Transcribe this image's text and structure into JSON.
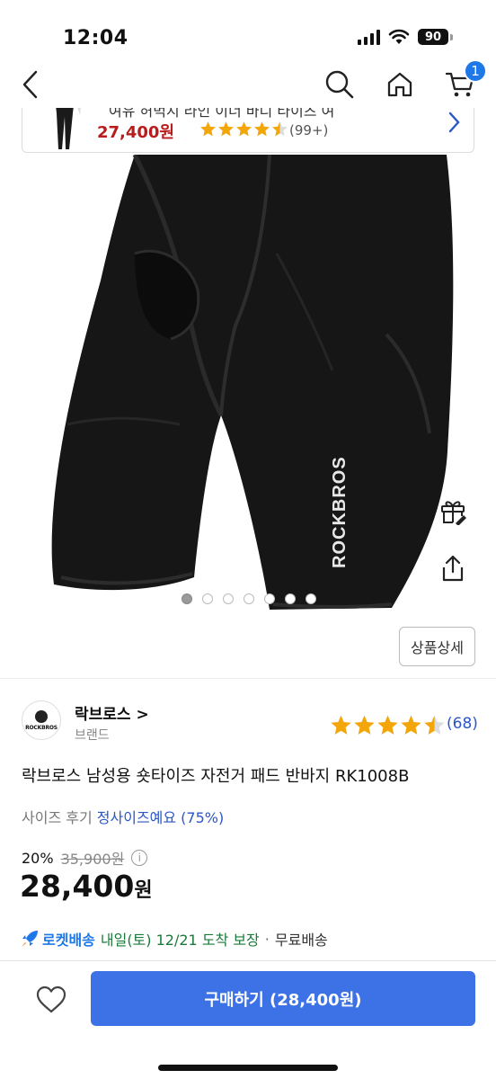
{
  "status_bar": {
    "time": "12:04",
    "battery": "90"
  },
  "nav": {
    "cart_count": "1"
  },
  "recommendation": {
    "title": "여유 허벅지 라인 이너 바디 타이츠 여",
    "price": "27,400원",
    "rating": 4.5,
    "review_count": "(99+)"
  },
  "product_image": {
    "brand_print": "ROCKBROS",
    "total_images": 7,
    "active_index": 0
  },
  "detail_button": "상품상세",
  "brand": {
    "name": "락브로스 >",
    "sub": "브랜드",
    "logo_text": "ROCKBROS"
  },
  "rating": {
    "value": 4.5,
    "count": "(68)"
  },
  "product_title": "락브로스 남성용 숏타이즈 자전거 패드 반바지 RK1008B",
  "size_review": {
    "label": "사이즈 후기",
    "value": "정사이즈예요 (75%)"
  },
  "pricing": {
    "discount_rate": "20%",
    "original_price": "35,900원",
    "info_icon": "i",
    "price": "28,400",
    "unit": "원"
  },
  "delivery": {
    "rocket_label": "로켓배송",
    "date": "내일(토) 12/21 도착 보장",
    "separator": "·",
    "shipping": "무료배송"
  },
  "cta": {
    "buy_label": "구매하기 (28,400원)"
  },
  "colors": {
    "accent": "#3d72e6",
    "star": "#f2a60a",
    "price_red": "#b81c1c",
    "link_blue": "#2a56c6"
  }
}
